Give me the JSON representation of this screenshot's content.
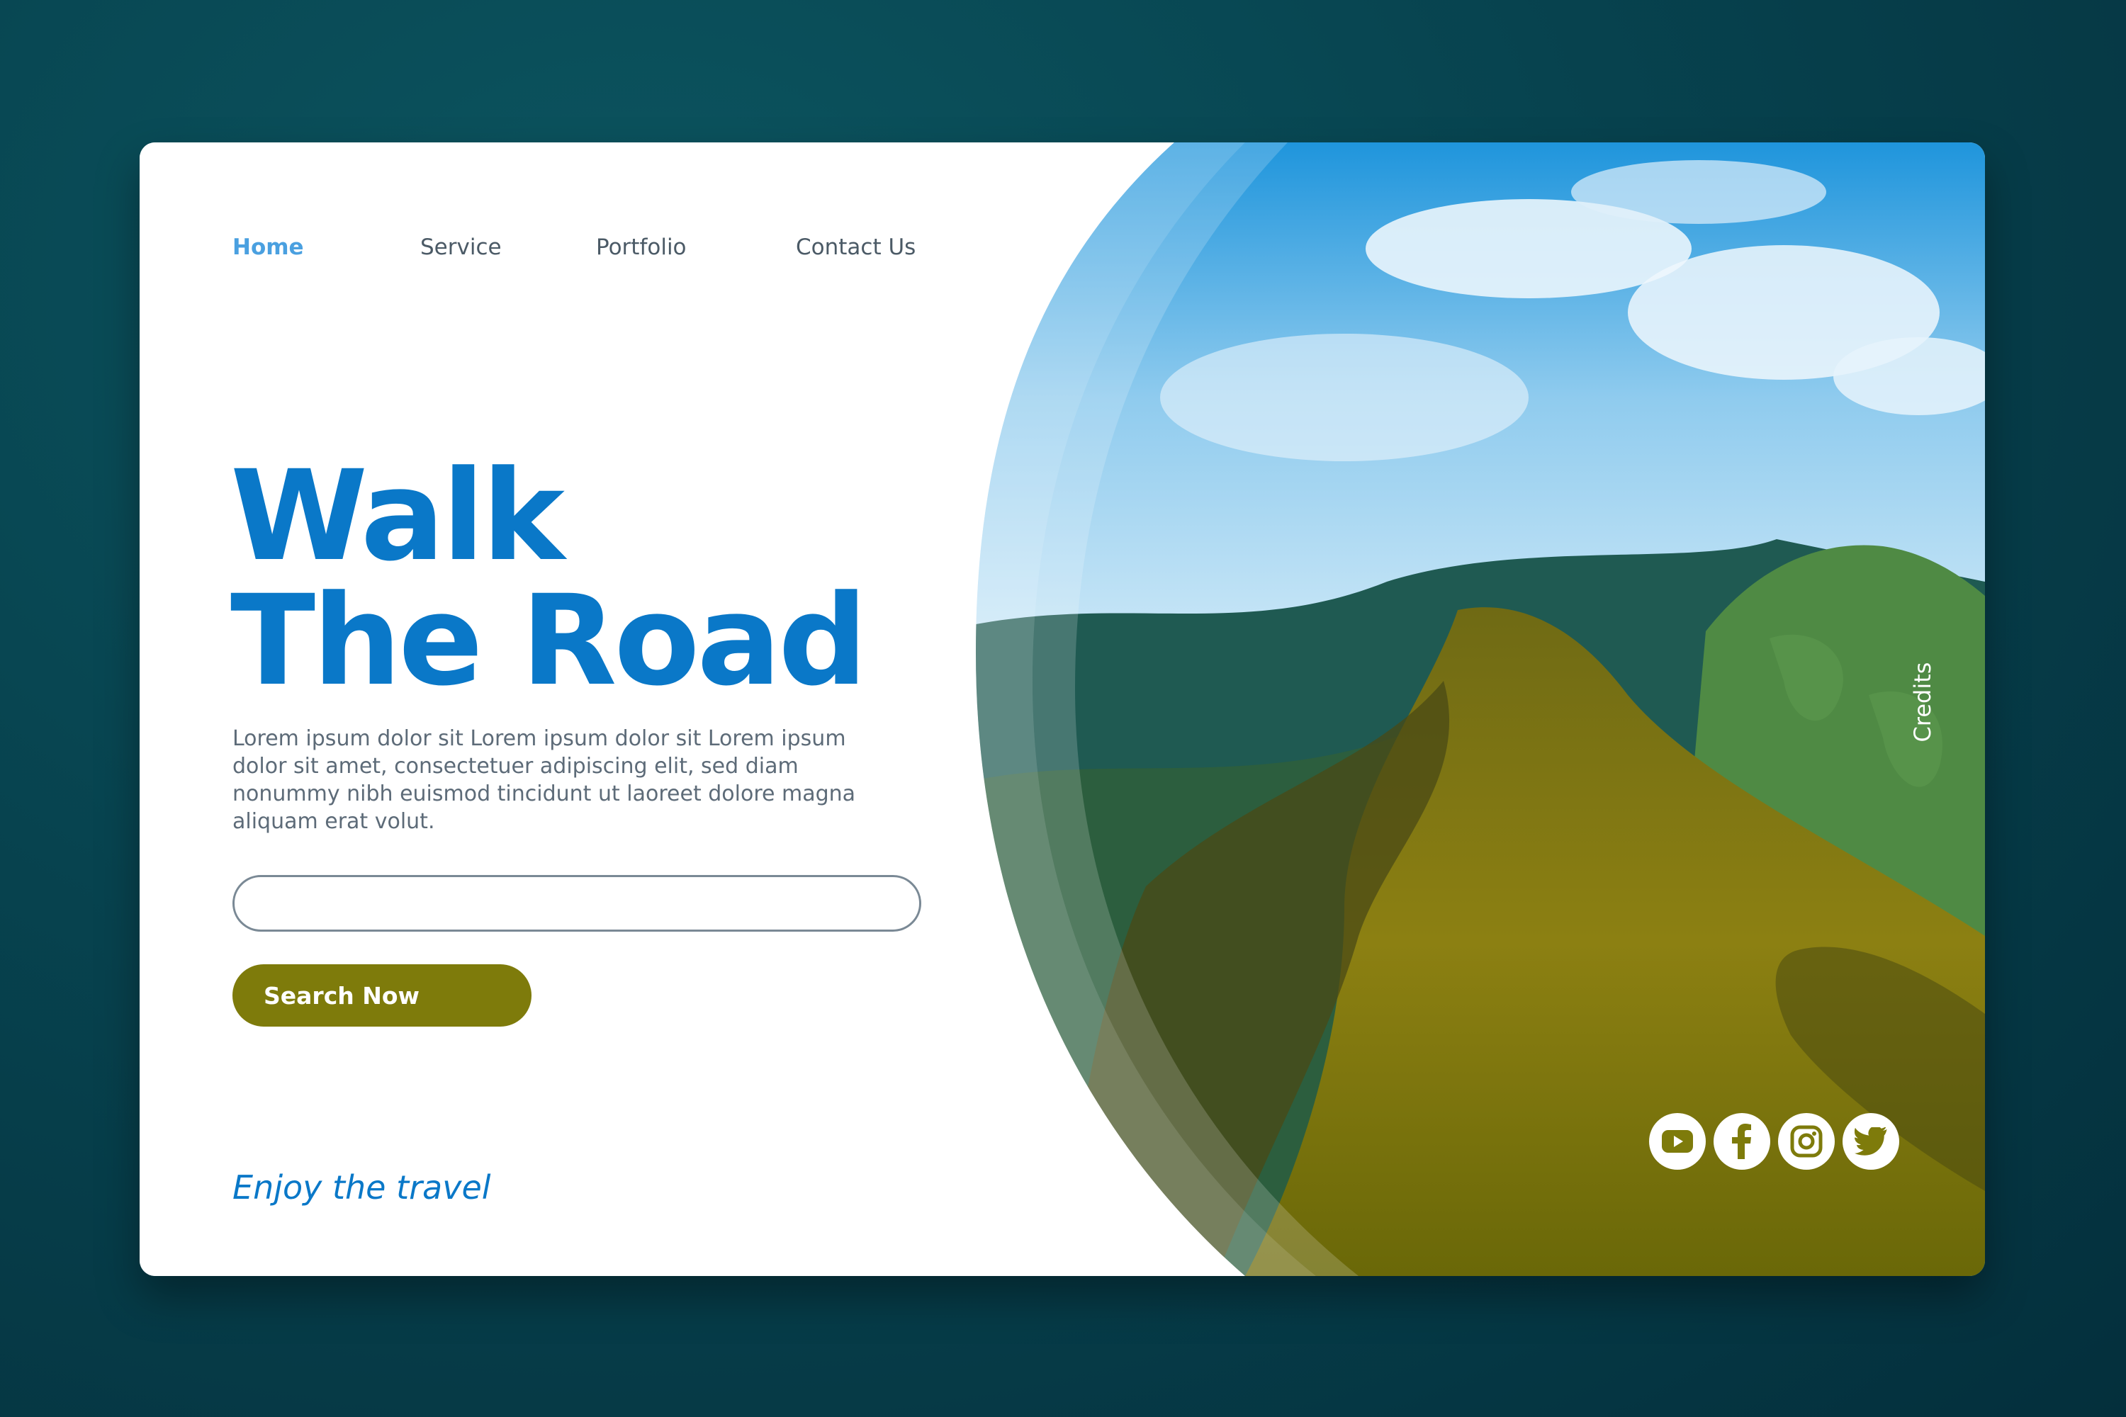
{
  "nav": {
    "items": [
      {
        "label": "Home",
        "active": true
      },
      {
        "label": "Service"
      },
      {
        "label": "Portfolio"
      },
      {
        "label": "Contact Us"
      }
    ]
  },
  "hero": {
    "title_line1": "Walk",
    "title_line2": "The Road",
    "description": "Lorem ipsum dolor sit Lorem ipsum dolor sit Lorem ipsum dolor sit amet, consectetuer adipiscing elit, sed diam nonummy nibh euismod tincidunt ut laoreet dolore magna aliquam erat volut.",
    "search_value": "",
    "search_button": "Search Now",
    "tagline": "Enjoy the travel"
  },
  "credits_label": "Credits",
  "social": [
    "youtube-icon",
    "facebook-icon",
    "instagram-icon",
    "twitter-icon"
  ],
  "colors": {
    "title": "#0a78c8",
    "nav_active": "#4aa0e0",
    "button": "#7e7b0b",
    "background": "#07434f",
    "hill_green": "#4f8a44",
    "path_olive": "#8a7e10"
  }
}
